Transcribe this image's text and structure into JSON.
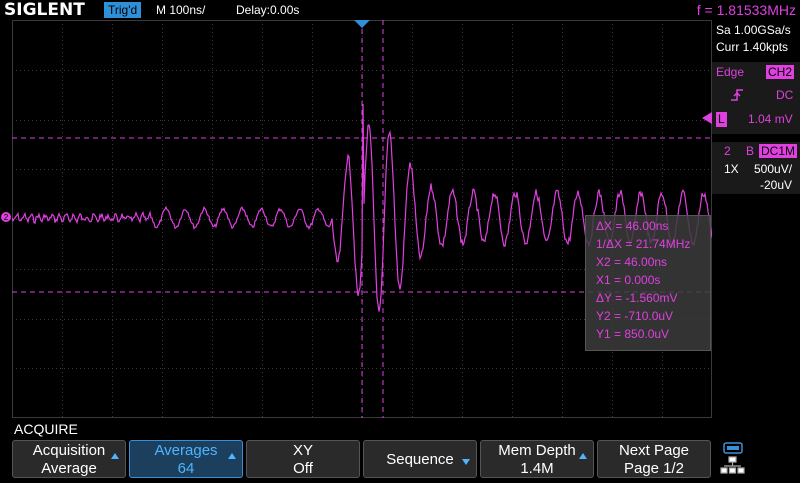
{
  "header": {
    "logo": "SIGLENT",
    "trigger_status": "Trig'd",
    "timebase": "M 100ns/",
    "delay": "Delay:0.00s",
    "frequency": "f = 1.81533MHz"
  },
  "acquisition_info": {
    "sample_rate": "Sa 1.00GSa/s",
    "memory": "Curr 1.40kpts"
  },
  "trigger": {
    "type": "Edge",
    "source": "CH2",
    "coupling": "DC",
    "level_label": "L",
    "level": "1.04 mV"
  },
  "channel": {
    "number": "2",
    "bw_label": "B",
    "coupling": "DC1M",
    "probe": "1X",
    "scale": "500uV/",
    "offset": "-20uV"
  },
  "cursors": {
    "rows": [
      "ΔX = 46.00ns",
      "1/ΔX = 21.74MHz",
      "X2 = 46.00ns",
      "X1 = 0.000s",
      "ΔY = -1.560mV",
      "Y2 = -710.0uV",
      "Y1 = 850.0uV"
    ]
  },
  "menu": {
    "title": "ACQUIRE",
    "buttons": [
      {
        "line1": "Acquisition",
        "line2": "Average"
      },
      {
        "line1": "Averages",
        "line2": "64"
      },
      {
        "line1": "XY",
        "line2": "Off"
      },
      {
        "line1": "Sequence",
        "line2": ""
      },
      {
        "line1": "Mem Depth",
        "line2": "1.4M"
      },
      {
        "line1": "Next Page",
        "line2": "Page 1/2"
      }
    ]
  },
  "colors": {
    "channel2": "#e040e0",
    "accent": "#2f8fd8",
    "grid": "#3a3a3a"
  },
  "icons": [
    "arrow-up-icon",
    "arrow-down-icon",
    "usb-icon",
    "network-icon",
    "trigger-position-icon",
    "edge-rising-icon",
    "trigger-level-icon",
    "channel-offset-marker-icon"
  ]
}
